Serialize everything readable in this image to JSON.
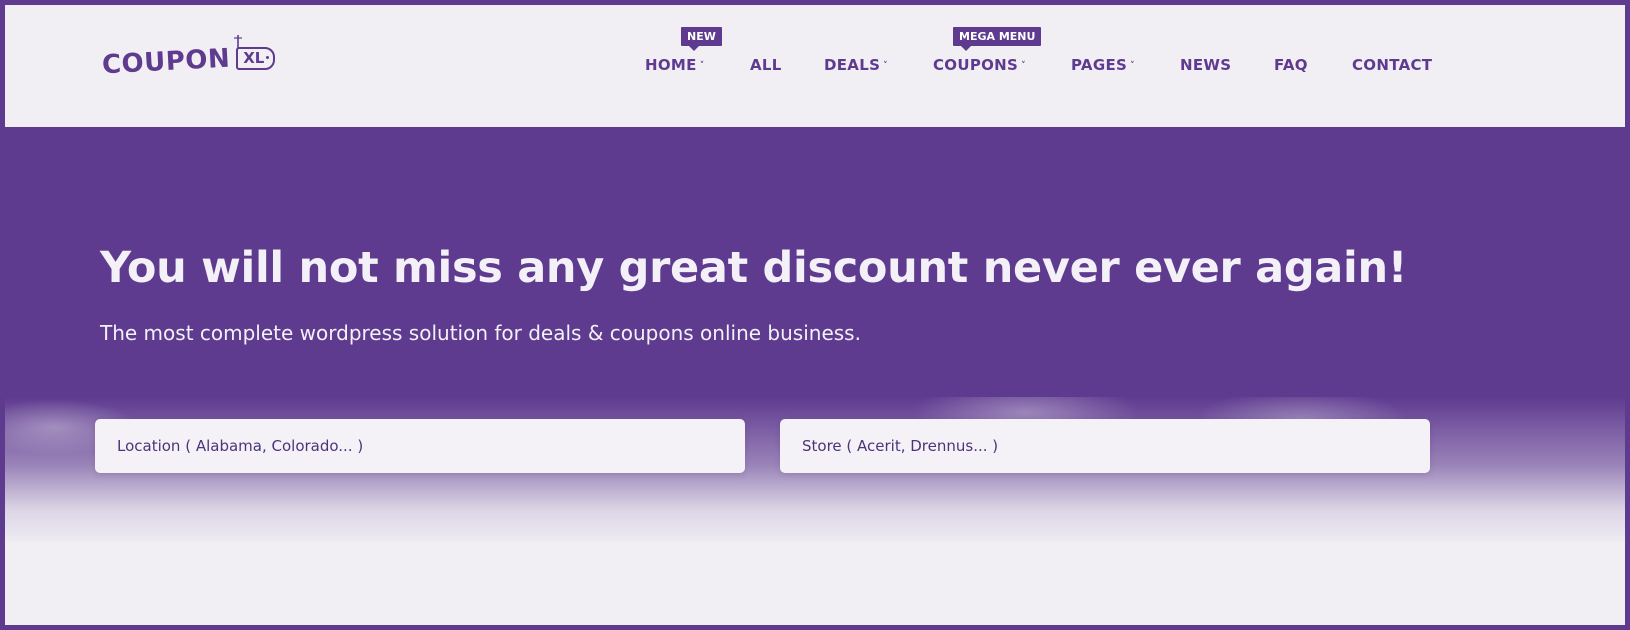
{
  "logo": {
    "text": "COUPON",
    "tag": "XL"
  },
  "nav": {
    "items": [
      {
        "label": "HOME",
        "dropdown": true,
        "badge": "NEW"
      },
      {
        "label": "ALL",
        "dropdown": false
      },
      {
        "label": "DEALS",
        "dropdown": true
      },
      {
        "label": "COUPONS",
        "dropdown": true,
        "badge": "MEGA MENU"
      },
      {
        "label": "PAGES",
        "dropdown": true
      },
      {
        "label": "NEWS",
        "dropdown": false
      },
      {
        "label": "FAQ",
        "dropdown": false
      },
      {
        "label": "CONTACT",
        "dropdown": false
      }
    ],
    "chevron": "˅"
  },
  "hero": {
    "title": "You will not miss any great discount never ever again!",
    "subtitle": "The most complete wordpress solution for deals & coupons online business."
  },
  "search": {
    "location_placeholder": "Location ( Alabama, Colorado... )",
    "store_placeholder": "Store ( Acerit, Drennus... )"
  },
  "colors": {
    "brand": "#5f3b90",
    "background": "#f1eff4",
    "hero_text": "#f3f0f7"
  },
  "icons": {
    "dropdown": "chevron-down-icon",
    "logo_spark": "spark-icon"
  }
}
